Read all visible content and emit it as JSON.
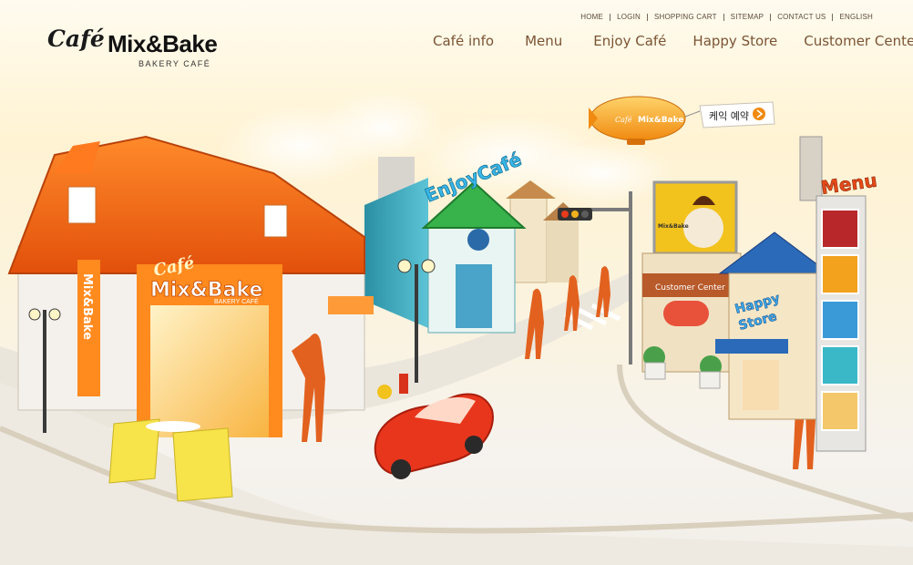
{
  "brand": {
    "script": "Café",
    "name": "Mix&Bake",
    "tagline": "BAKERY CAFÉ",
    "color_accent": "#f07a12",
    "color_nav": "#7a5434"
  },
  "utility_nav": [
    {
      "label": "HOME"
    },
    {
      "label": "LOGIN"
    },
    {
      "label": "SHOPPING CART"
    },
    {
      "label": "SITEMAP"
    },
    {
      "label": "CONTACT US"
    },
    {
      "label": "ENGLISH"
    }
  ],
  "main_nav": [
    {
      "label": "Café info"
    },
    {
      "label": "Menu"
    },
    {
      "label": "Enjoy Café"
    },
    {
      "label": "Happy Store"
    },
    {
      "label": "Customer Center"
    }
  ],
  "illustration": {
    "shop_sign_script": "Café",
    "shop_sign_name": "Mix&Bake",
    "shop_sign_tagline": "BAKERY CAFÉ",
    "vertical_sign": "Mix&Bake",
    "enjoy_sign": "EnjoyCafé",
    "menu_sign": "Menu",
    "customer_center_sign": "Customer Center",
    "happy_store_sign_1": "Happy",
    "happy_store_sign_2": "Store",
    "blimp_label": "Mix&Bake",
    "banner_label": "케익 예약",
    "billboard_label": "Mix&Bake"
  }
}
